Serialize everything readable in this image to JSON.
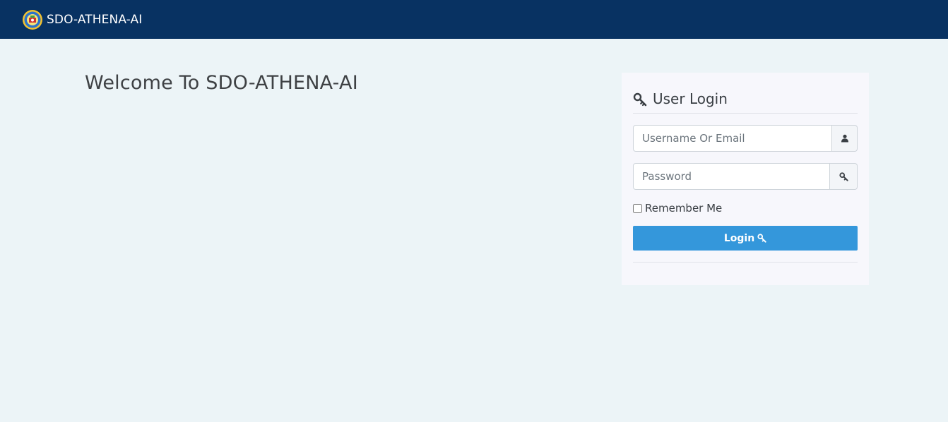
{
  "navbar": {
    "brand_text": "SDO-ATHENA-AI",
    "logo_icon": "school-seal-logo",
    "background": "#083262"
  },
  "main": {
    "welcome_title": "Welcome To SDO-ATHENA-AI"
  },
  "login_card": {
    "title": "User Login",
    "title_icon": "key-icon",
    "username": {
      "value": "",
      "placeholder": "Username Or Email",
      "addon_icon": "user-icon"
    },
    "password": {
      "value": "",
      "placeholder": "Password",
      "addon_icon": "key-icon"
    },
    "remember_me": {
      "label": "Remember Me",
      "checked": false
    },
    "login_button": {
      "label": "Login",
      "icon": "key-icon",
      "color": "#3497db"
    }
  },
  "colors": {
    "page_background": "#ecf4f7",
    "card_background": "#f7f7fc"
  }
}
